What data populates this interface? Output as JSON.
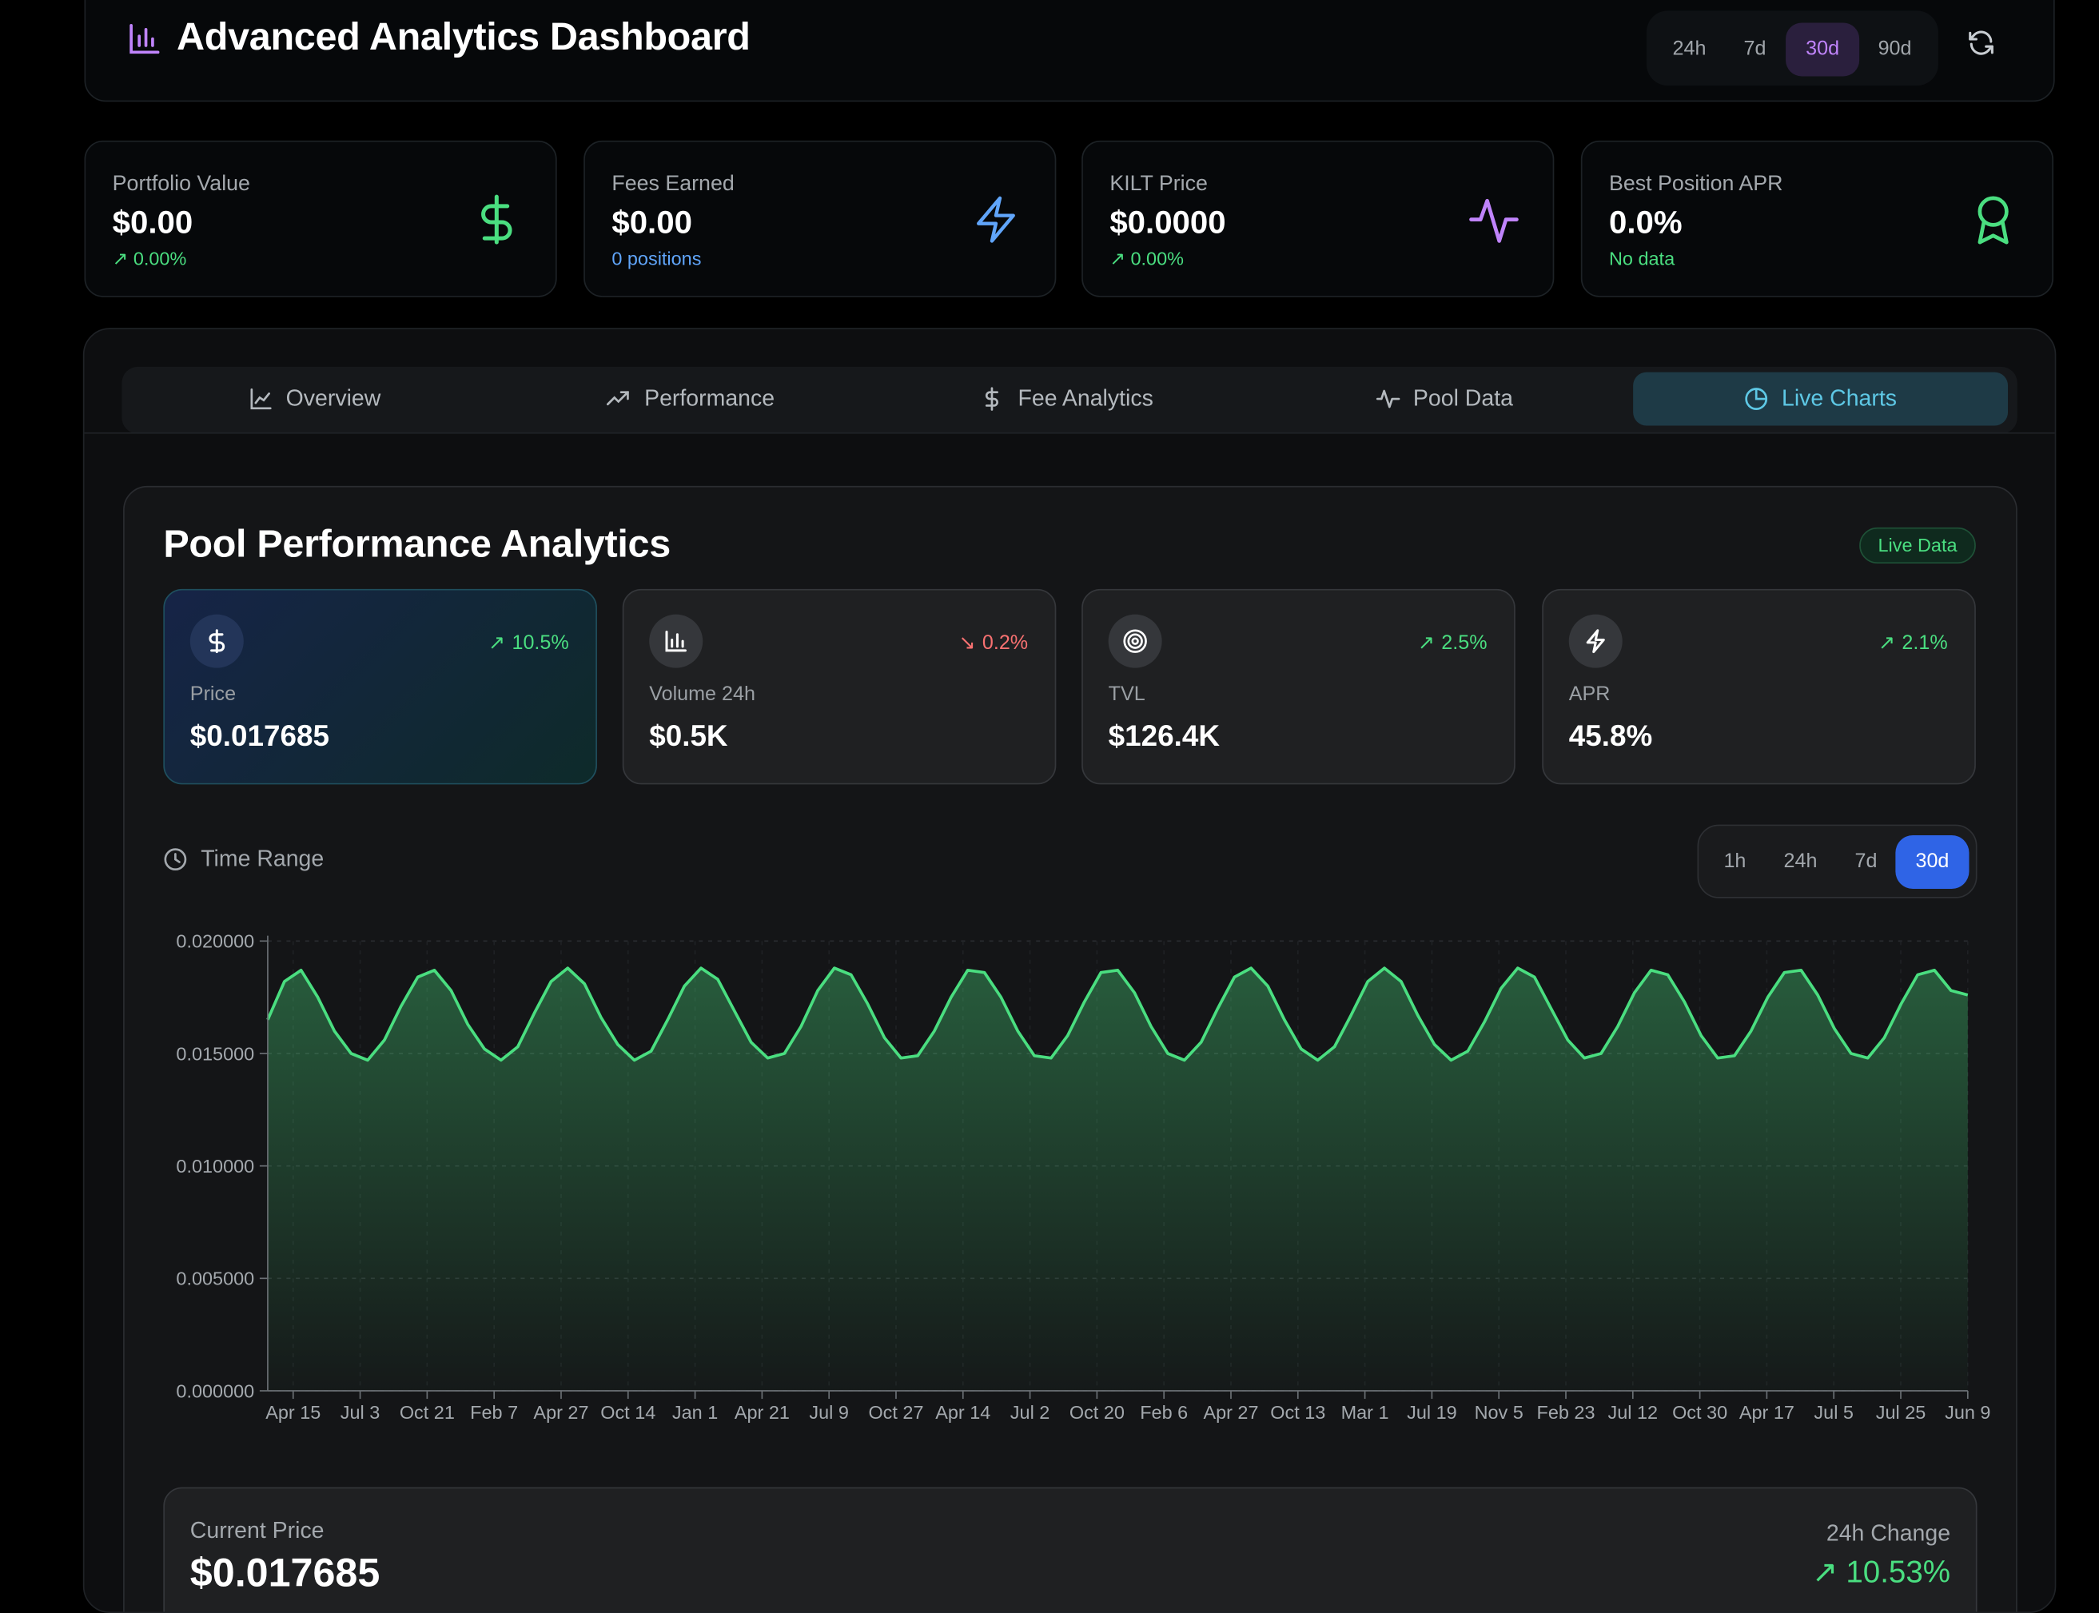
{
  "header": {
    "title": "Advanced Analytics Dashboard",
    "ranges": [
      "24h",
      "7d",
      "30d",
      "90d"
    ],
    "active_range": "30d",
    "accent": "#c084fc"
  },
  "stats": [
    {
      "label": "Portfolio Value",
      "value": "$0.00",
      "sub": "0.00%",
      "icon": "dollar-icon",
      "color": "#4ade80"
    },
    {
      "label": "Fees Earned",
      "value": "$0.00",
      "sub": "0 positions",
      "icon": "lightning-icon",
      "color": "#60a5fa"
    },
    {
      "label": "KILT Price",
      "value": "$0.0000",
      "sub": "0.00%",
      "icon": "activity-icon",
      "color": "#c084fc"
    },
    {
      "label": "Best Position APR",
      "value": "0.0%",
      "sub": "No data",
      "icon": "award-icon",
      "color": "#4ade80"
    }
  ],
  "tabs": [
    "Overview",
    "Performance",
    "Fee Analytics",
    "Pool Data",
    "Live Charts"
  ],
  "active_tab": "Live Charts",
  "analytics": {
    "title": "Pool Performance Analytics",
    "badge": "Live Data",
    "metrics": [
      {
        "label": "Price",
        "value": "$0.017685",
        "change": "10.5%",
        "direction": "up",
        "icon": "dollar-icon"
      },
      {
        "label": "Volume 24h",
        "value": "$0.5K",
        "change": "0.2%",
        "direction": "down",
        "icon": "bar-chart-icon"
      },
      {
        "label": "TVL",
        "value": "$126.4K",
        "change": "2.5%",
        "direction": "up",
        "icon": "target-icon"
      },
      {
        "label": "APR",
        "value": "45.8%",
        "change": "2.1%",
        "direction": "up",
        "icon": "lightning-icon"
      }
    ],
    "time_range_label": "Time Range",
    "time_ranges": [
      "1h",
      "24h",
      "7d",
      "30d"
    ],
    "active_time_range": "30d",
    "current_price_label": "Current Price",
    "current_price": "$0.017685",
    "change_label": "24h Change",
    "change_value": "10.53%"
  },
  "chart_data": {
    "type": "area",
    "title": "",
    "xlabel": "",
    "ylabel": "",
    "ylim": [
      0,
      0.02
    ],
    "yticks": [
      "0.000000",
      "0.005000",
      "0.010000",
      "0.015000",
      "0.020000"
    ],
    "xticks": [
      "Apr 15",
      "Jul 3",
      "Oct 21",
      "Feb 7",
      "Apr 27",
      "Oct 14",
      "Jan 1",
      "Apr 21",
      "Jul 9",
      "Oct 27",
      "Apr 14",
      "Jul 2",
      "Oct 20",
      "Feb 6",
      "Apr 27",
      "Oct 13",
      "Mar 1",
      "Jul 19",
      "Nov 5",
      "Feb 23",
      "Jul 12",
      "Oct 30",
      "Apr 17",
      "Jul 5",
      "Jul 25",
      "Jun 9"
    ],
    "grid": true,
    "color": "#4ade80",
    "series": [
      {
        "values": [
          0.0165,
          0.0182,
          0.0187,
          0.0175,
          0.016,
          0.015,
          0.0147,
          0.0156,
          0.0171,
          0.0184,
          0.0187,
          0.0178,
          0.0163,
          0.0152,
          0.0147,
          0.0153,
          0.0168,
          0.0182,
          0.0188,
          0.0181,
          0.0166,
          0.0154,
          0.0147,
          0.0151,
          0.0165,
          0.018,
          0.0188,
          0.0183,
          0.0169,
          0.0155,
          0.0148,
          0.015,
          0.0162,
          0.0178,
          0.0188,
          0.0185,
          0.0172,
          0.0157,
          0.0148,
          0.0149,
          0.016,
          0.0175,
          0.0187,
          0.0186,
          0.0175,
          0.016,
          0.0149,
          0.0148,
          0.0158,
          0.0173,
          0.0186,
          0.0187,
          0.0177,
          0.0162,
          0.015,
          0.0147,
          0.0155,
          0.017,
          0.0184,
          0.0188,
          0.018,
          0.0165,
          0.0152,
          0.0147,
          0.0153,
          0.0167,
          0.0182,
          0.0188,
          0.0182,
          0.0167,
          0.0154,
          0.0147,
          0.0151,
          0.0164,
          0.0179,
          0.0188,
          0.0184,
          0.017,
          0.0156,
          0.0148,
          0.015,
          0.0162,
          0.0177,
          0.0187,
          0.0185,
          0.0173,
          0.0158,
          0.0148,
          0.0149,
          0.016,
          0.0175,
          0.0186,
          0.0187,
          0.0176,
          0.0161,
          0.015,
          0.0148,
          0.0157,
          0.0172,
          0.0185,
          0.0187,
          0.0178,
          0.0176
        ]
      }
    ]
  }
}
